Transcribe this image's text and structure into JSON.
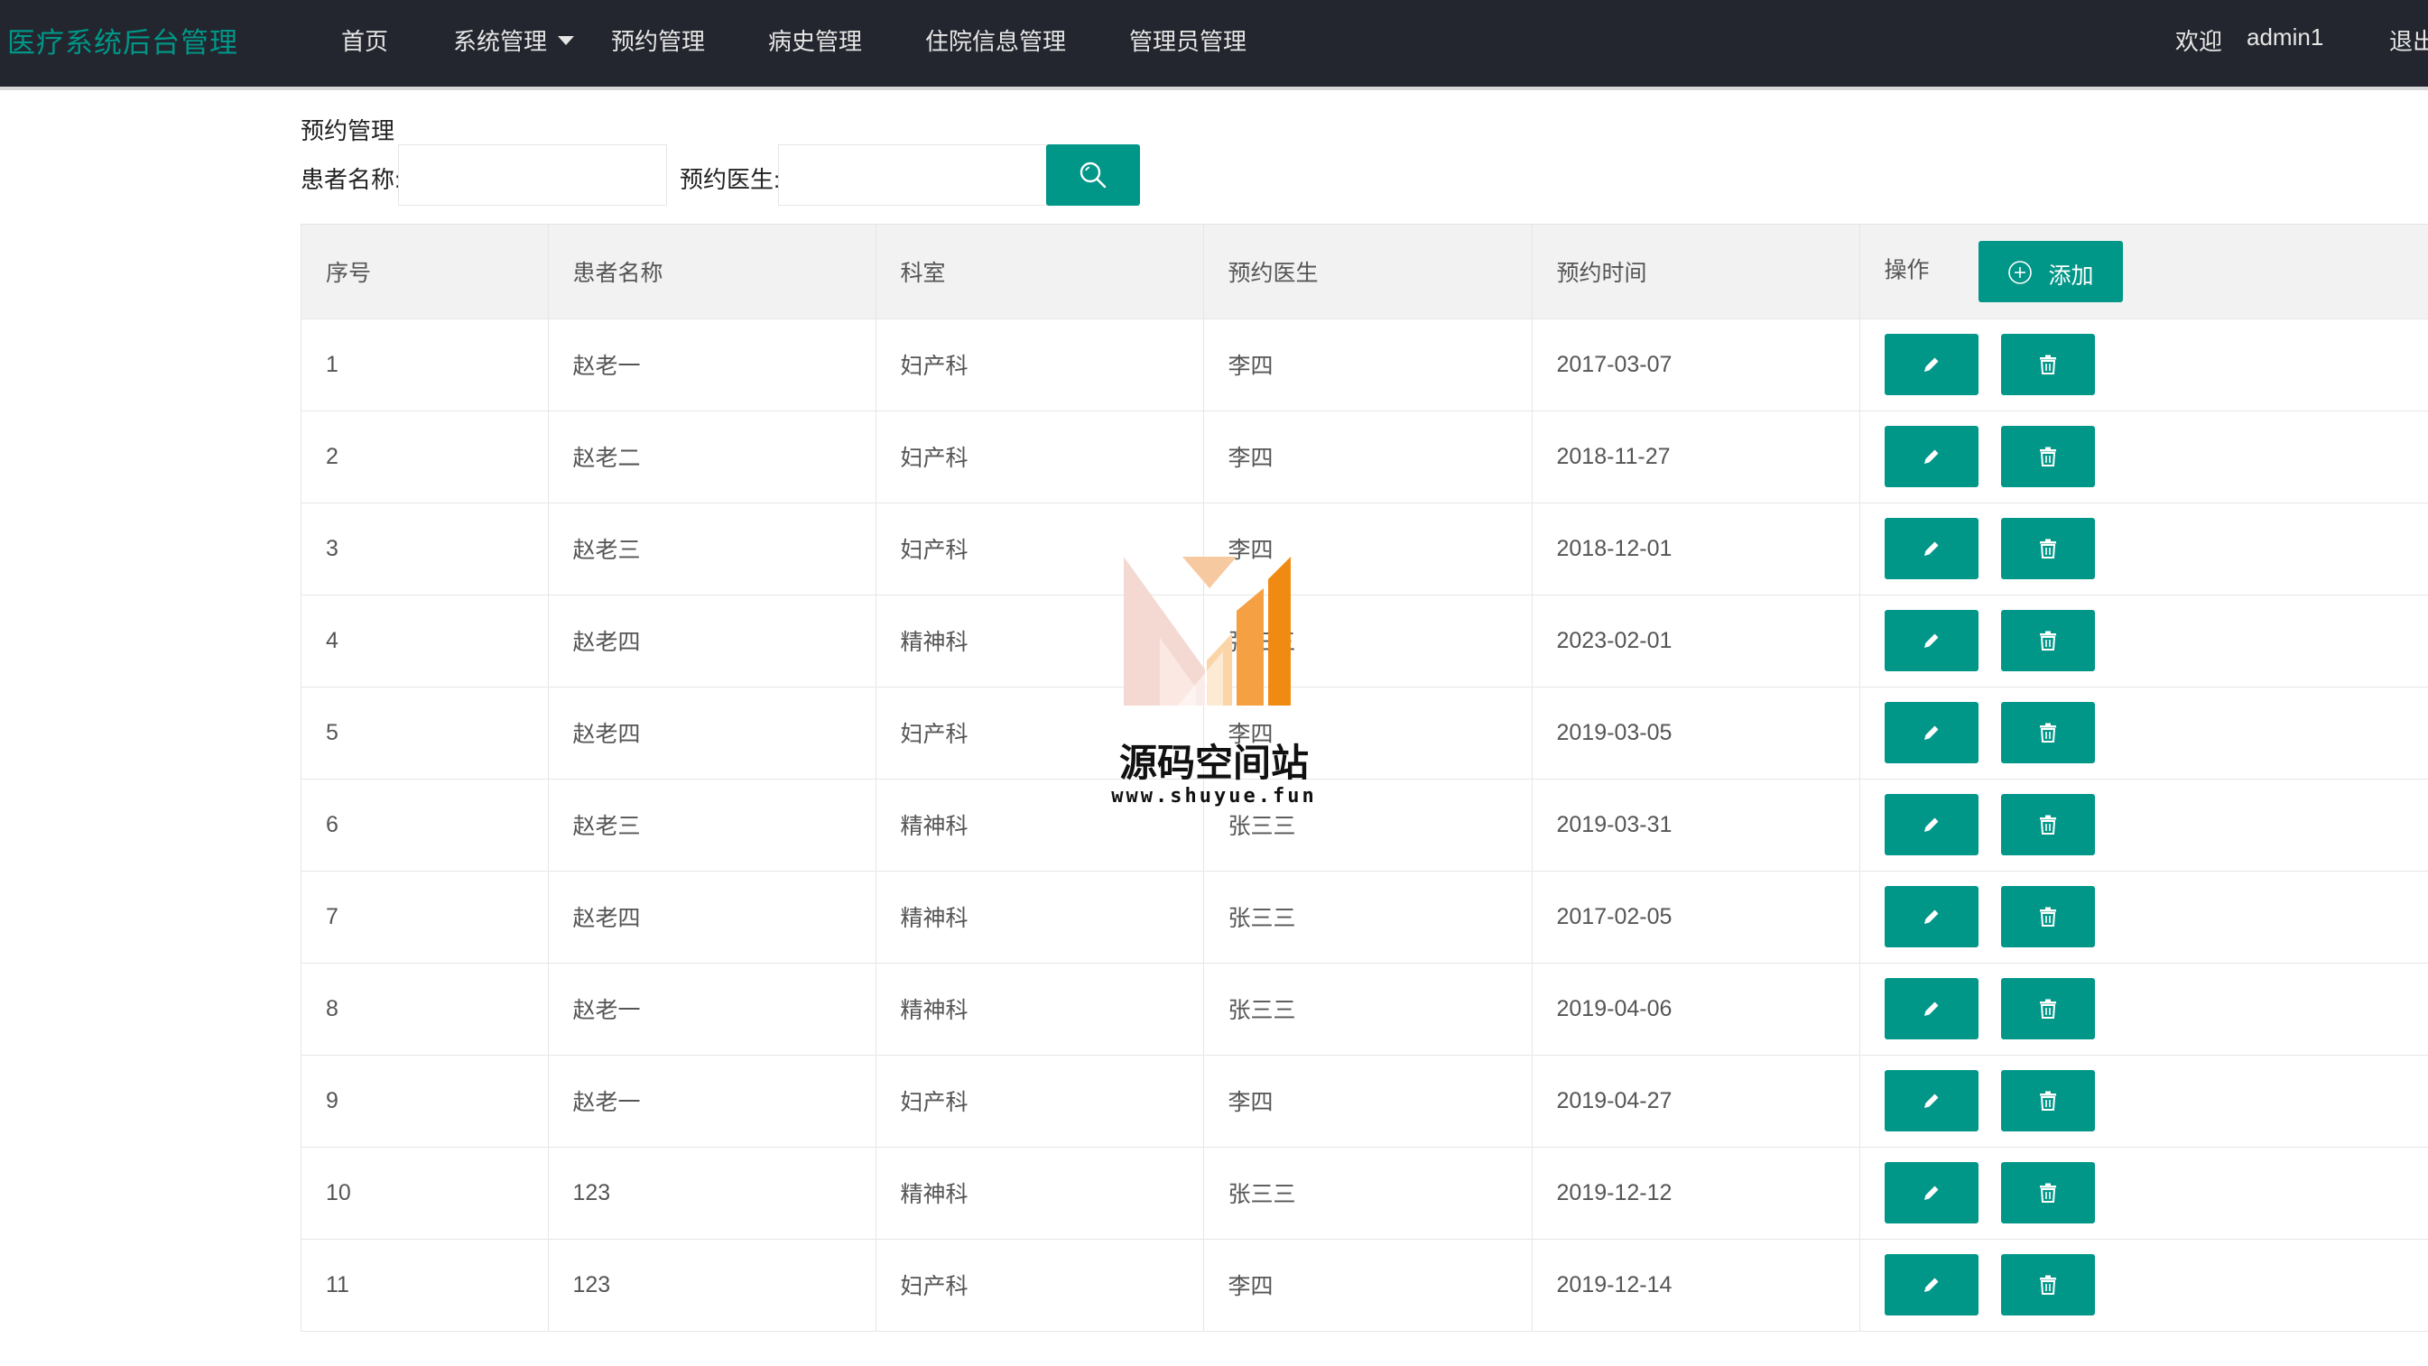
{
  "app": {
    "brand": "医疗系统后台管理",
    "accent_color": "#009688",
    "topbar_color": "#23262e"
  },
  "nav": {
    "items": [
      {
        "label": "首页"
      },
      {
        "label": "系统管理",
        "has_dropdown": true
      },
      {
        "label": "预约管理"
      },
      {
        "label": "病史管理"
      },
      {
        "label": "住院信息管理"
      },
      {
        "label": "管理员管理"
      }
    ]
  },
  "user": {
    "welcome": "欢迎",
    "name": "admin1",
    "logout": "退出"
  },
  "page": {
    "title": "预约管理"
  },
  "filters": {
    "patient_label": "患者名称:",
    "patient_value": "",
    "doctor_label": "预约医生:",
    "doctor_value": "",
    "search_icon": "search-icon"
  },
  "table": {
    "headers": [
      "序号",
      "患者名称",
      "科室",
      "预约医生",
      "预约时间",
      "操作"
    ],
    "add_label": "添加",
    "rows": [
      {
        "id": "1",
        "patient": "赵老一",
        "dept": "妇产科",
        "doctor": "李四",
        "time": "2017-03-07"
      },
      {
        "id": "2",
        "patient": "赵老二",
        "dept": "妇产科",
        "doctor": "李四",
        "time": "2018-11-27"
      },
      {
        "id": "3",
        "patient": "赵老三",
        "dept": "妇产科",
        "doctor": "李四",
        "time": "2018-12-01"
      },
      {
        "id": "4",
        "patient": "赵老四",
        "dept": "精神科",
        "doctor": "张三三",
        "time": "2023-02-01"
      },
      {
        "id": "5",
        "patient": "赵老四",
        "dept": "妇产科",
        "doctor": "李四",
        "time": "2019-03-05"
      },
      {
        "id": "6",
        "patient": "赵老三",
        "dept": "精神科",
        "doctor": "张三三",
        "time": "2019-03-31"
      },
      {
        "id": "7",
        "patient": "赵老四",
        "dept": "精神科",
        "doctor": "张三三",
        "time": "2017-02-05"
      },
      {
        "id": "8",
        "patient": "赵老一",
        "dept": "精神科",
        "doctor": "张三三",
        "time": "2019-04-06"
      },
      {
        "id": "9",
        "patient": "赵老一",
        "dept": "妇产科",
        "doctor": "李四",
        "time": "2019-04-27"
      },
      {
        "id": "10",
        "patient": "123",
        "dept": "精神科",
        "doctor": "张三三",
        "time": "2019-12-12"
      },
      {
        "id": "11",
        "patient": "123",
        "dept": "妇产科",
        "doctor": "李四",
        "time": "2019-12-14"
      }
    ],
    "row_actions": {
      "edit_icon": "pencil-icon",
      "delete_icon": "trash-icon"
    }
  },
  "watermark": {
    "title": "源码空间站",
    "url": "www.shuyue.fun"
  }
}
